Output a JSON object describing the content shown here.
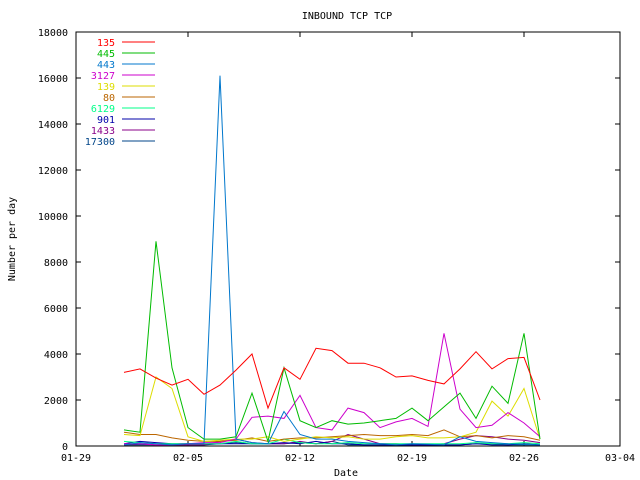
{
  "chart_data": {
    "type": "line",
    "title": "INBOUND TCP TCP",
    "xlabel": "Date",
    "ylabel": "Number per day",
    "xlim": [
      "01-29",
      "03-04"
    ],
    "ylim": [
      0,
      18000
    ],
    "x_ticks": [
      "01-29",
      "02-05",
      "02-12",
      "02-19",
      "02-26",
      "03-04"
    ],
    "y_ticks": [
      0,
      2000,
      4000,
      6000,
      8000,
      10000,
      12000,
      14000,
      16000,
      18000
    ],
    "grid": false,
    "legend_position": "top-left",
    "x": [
      "02-01",
      "02-02",
      "02-03",
      "02-04",
      "02-05",
      "02-06",
      "02-07",
      "02-08",
      "02-09",
      "02-10",
      "02-11",
      "02-12",
      "02-13",
      "02-14",
      "02-15",
      "02-16",
      "02-17",
      "02-18",
      "02-19",
      "02-20",
      "02-21",
      "02-22",
      "02-23",
      "02-24",
      "02-25",
      "02-26",
      "02-27"
    ],
    "series": [
      {
        "name": "135",
        "color": "#ff0000",
        "values": [
          3200,
          3350,
          2950,
          2650,
          2900,
          2250,
          2650,
          3300,
          4000,
          1650,
          3400,
          2900,
          4250,
          4150,
          3600,
          3600,
          3400,
          3000,
          3050,
          2850,
          2700,
          3350,
          4100,
          3350,
          3800,
          3850,
          2000
        ]
      },
      {
        "name": "445",
        "color": "#00bb00",
        "values": [
          700,
          600,
          8900,
          3400,
          800,
          300,
          300,
          400,
          2300,
          200,
          3400,
          1100,
          800,
          1100,
          950,
          1000,
          1100,
          1200,
          1650,
          1100,
          1700,
          2300,
          1200,
          2600,
          1850,
          4900,
          300
        ]
      },
      {
        "name": "443",
        "color": "#0077cc",
        "values": [
          50,
          150,
          100,
          50,
          100,
          100,
          16100,
          300,
          150,
          100,
          1500,
          500,
          300,
          300,
          200,
          150,
          100,
          50,
          100,
          80,
          50,
          400,
          200,
          150,
          100,
          80,
          50
        ]
      },
      {
        "name": "3127",
        "color": "#cc00cc",
        "values": [
          100,
          100,
          50,
          50,
          100,
          150,
          150,
          300,
          1250,
          1300,
          1200,
          2200,
          800,
          700,
          1650,
          1450,
          800,
          1050,
          1200,
          850,
          4900,
          1600,
          800,
          900,
          1450,
          1000,
          400
        ]
      },
      {
        "name": "139",
        "color": "#dddd00",
        "values": [
          500,
          450,
          3000,
          2500,
          400,
          200,
          250,
          300,
          300,
          400,
          200,
          300,
          400,
          350,
          400,
          300,
          300,
          400,
          450,
          350,
          350,
          400,
          600,
          1950,
          1300,
          2500,
          300
        ]
      },
      {
        "name": "80",
        "color": "#bb6600",
        "values": [
          600,
          500,
          500,
          350,
          250,
          200,
          200,
          250,
          350,
          200,
          300,
          350,
          350,
          400,
          450,
          500,
          450,
          450,
          500,
          450,
          700,
          400,
          450,
          350,
          450,
          400,
          250
        ]
      },
      {
        "name": "6129",
        "color": "#00ff88",
        "values": [
          200,
          150,
          100,
          100,
          100,
          100,
          100,
          200,
          100,
          100,
          300,
          150,
          100,
          100,
          150,
          100,
          100,
          100,
          100,
          100,
          100,
          100,
          150,
          100,
          100,
          150,
          100
        ]
      },
      {
        "name": "901",
        "color": "#0000aa",
        "values": [
          100,
          200,
          150,
          100,
          100,
          100,
          100,
          100,
          100,
          100,
          150,
          100,
          200,
          100,
          100,
          50,
          50,
          50,
          50,
          50,
          50,
          50,
          100,
          50,
          50,
          100,
          50
        ]
      },
      {
        "name": "1433",
        "color": "#880088",
        "values": [
          50,
          100,
          50,
          50,
          50,
          50,
          200,
          300,
          150,
          100,
          100,
          200,
          100,
          200,
          500,
          300,
          100,
          100,
          50,
          50,
          100,
          300,
          450,
          400,
          300,
          250,
          150
        ]
      },
      {
        "name": "17300",
        "color": "#004488",
        "values": [
          50,
          50,
          50,
          50,
          50,
          50,
          100,
          150,
          100,
          100,
          100,
          150,
          100,
          200,
          50,
          50,
          50,
          50,
          50,
          50,
          50,
          50,
          100,
          100,
          50,
          50,
          50
        ]
      }
    ]
  }
}
